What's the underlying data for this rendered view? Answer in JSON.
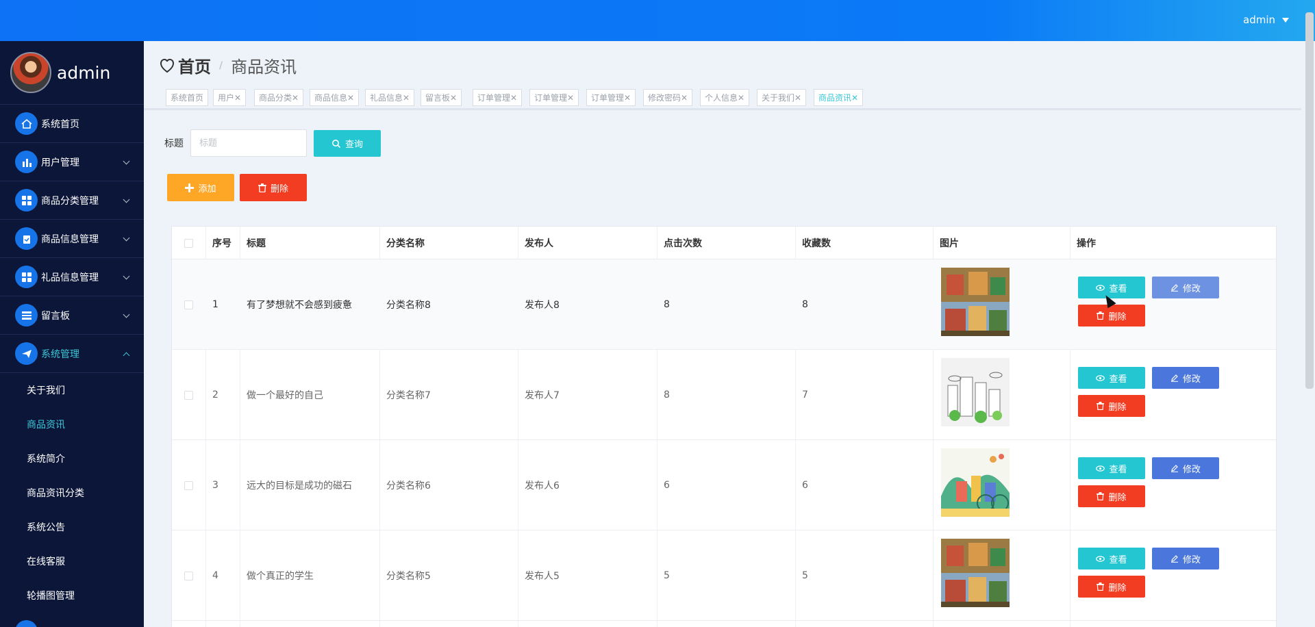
{
  "colors": {
    "primary": "#1774e8",
    "query": "#24c6d2",
    "add": "#fea727",
    "danger": "#f23d22",
    "edit": "#4b77dc",
    "active_text": "#3cc7d8",
    "sidebar_bg": "#0c1638"
  },
  "header": {
    "user": "admin"
  },
  "sidebar": {
    "username": "admin",
    "items": [
      {
        "label": "系统首页",
        "icon": "home-icon"
      },
      {
        "label": "用户管理",
        "icon": "bar-chart-icon"
      },
      {
        "label": "商品分类管理",
        "icon": "grid-icon"
      },
      {
        "label": "商品信息管理",
        "icon": "goods-icon"
      },
      {
        "label": "礼品信息管理",
        "icon": "grid-icon"
      },
      {
        "label": "留言板",
        "icon": "list-icon"
      },
      {
        "label": "系统管理",
        "icon": "paper-plane-icon"
      }
    ],
    "sub_items": [
      "关于我们",
      "商品资讯",
      "系统简介",
      "商品资讯分类",
      "系统公告",
      "在线客服",
      "轮播图管理"
    ]
  },
  "breadcrumb": {
    "home": "首页",
    "separator": "/",
    "current": "商品资讯"
  },
  "tags": [
    "系统首页",
    "用户",
    "商品分类",
    "商品信息",
    "礼品信息",
    "留言板",
    "订单管理",
    "订单管理",
    "订单管理",
    "修改密码",
    "个人信息",
    "关于我们",
    "商品资讯"
  ],
  "search": {
    "label": "标题",
    "placeholder": "标题",
    "button": "查询"
  },
  "actions": {
    "add": "添加",
    "delete": "删除"
  },
  "table": {
    "headers": [
      "序号",
      "标题",
      "分类名称",
      "发布人",
      "点击次数",
      "收藏数",
      "图片",
      "操作"
    ],
    "rows": [
      {
        "no": "1",
        "title": "有了梦想就不会感到疲惫",
        "category": "分类名称8",
        "publisher": "发布人8",
        "clicks": "8",
        "favorites": "8"
      },
      {
        "no": "2",
        "title": "做一个最好的自己",
        "category": "分类名称7",
        "publisher": "发布人7",
        "clicks": "8",
        "favorites": "7"
      },
      {
        "no": "3",
        "title": "远大的目标是成功的磁石",
        "category": "分类名称6",
        "publisher": "发布人6",
        "clicks": "6",
        "favorites": "6"
      },
      {
        "no": "4",
        "title": "做个真正的学生",
        "category": "分类名称5",
        "publisher": "发布人5",
        "clicks": "5",
        "favorites": "5"
      }
    ],
    "ops": {
      "view": "查看",
      "edit": "修改",
      "delete": "删除"
    }
  }
}
